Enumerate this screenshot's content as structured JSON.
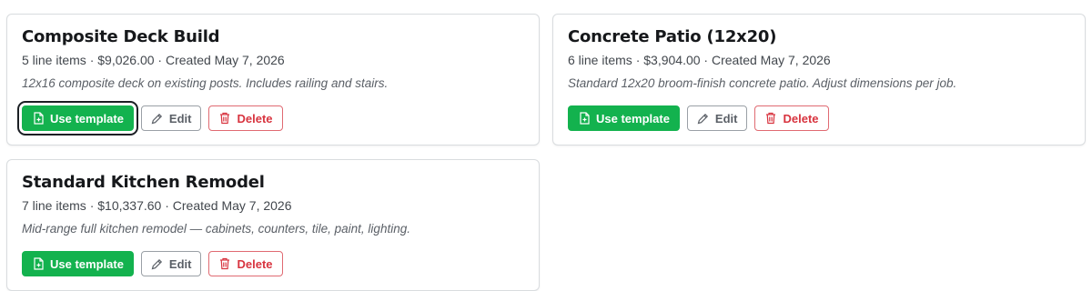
{
  "colors": {
    "use_template_bg": "#13b24e",
    "delete_accent": "#d8343f",
    "edit_border": "#9aa0a6"
  },
  "icons": {
    "use_template": "file-plus-icon",
    "edit": "pencil-icon",
    "delete": "trash-icon"
  },
  "templates": [
    {
      "title": "Composite Deck Build",
      "meta": "5 line items · $9,026.00 · Created May 7, 2026",
      "description": "12x16 composite deck on existing posts. Includes railing and stairs.",
      "use_label": "Use template",
      "edit_label": "Edit",
      "delete_label": "Delete"
    },
    {
      "title": "Concrete Patio (12x20)",
      "meta": "6 line items · $3,904.00 · Created May 7, 2026",
      "description": "Standard 12x20 broom-finish concrete patio. Adjust dimensions per job.",
      "use_label": "Use template",
      "edit_label": "Edit",
      "delete_label": "Delete"
    },
    {
      "title": "Standard Kitchen Remodel",
      "meta": "7 line items · $10,337.60 · Created May 7, 2026",
      "description": "Mid-range full kitchen remodel — cabinets, counters, tile, paint, lighting.",
      "use_label": "Use template",
      "edit_label": "Edit",
      "delete_label": "Delete"
    }
  ]
}
